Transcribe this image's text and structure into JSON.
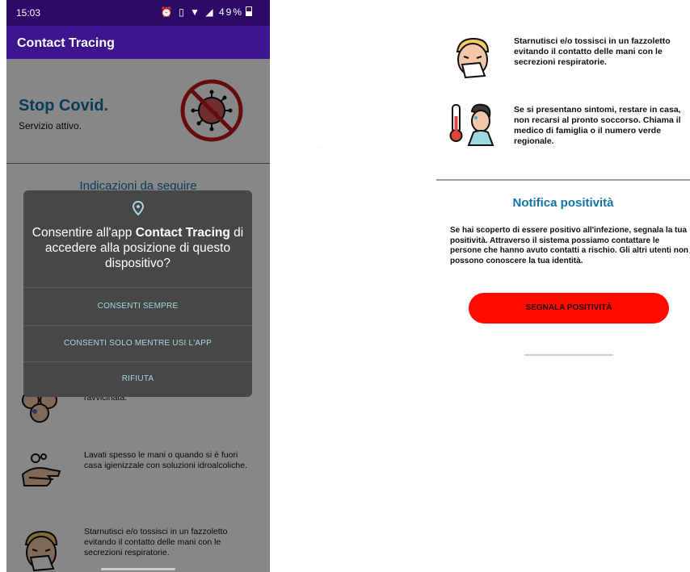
{
  "status_bar": {
    "time": "15:03",
    "battery": "49%"
  },
  "app_bar": {
    "title": "Contact Tracing"
  },
  "hero": {
    "title": "Stop Covid.",
    "subtitle": "Servizio attivo."
  },
  "section_left": {
    "title": "Indicazioni da seguire"
  },
  "tips_left": [
    {
      "text": "con scarsa ventilazione e la distanza ravvicinata.",
      "icon": "crowd-icon"
    },
    {
      "text": "Lavati spesso le mani o quando si è fuori casa igienizzale con soluzioni idroalcoliche.",
      "icon": "hand-wash-icon"
    },
    {
      "text": "Starnutisci e/o tossisci in un fazzoletto evitando il contatto delle mani con le secrezioni respiratorie.",
      "icon": "sneeze-icon"
    }
  ],
  "dialog": {
    "title_part1": "Consentire all'app ",
    "title_app": "Contact Tracing",
    "title_part2": " di accedere alla posizione di questo dispositivo?",
    "buttons": {
      "allow_always": "CONSENTI SEMPRE",
      "allow_while_using": "CONSENTI SOLO MENTRE USI L'APP",
      "deny": "RIFIUTA"
    }
  },
  "tips_right": [
    {
      "text": "Starnutisci e/o tossisci in un fazzoletto evitando il contatto delle mani con le secrezioni respiratorie.",
      "icon": "sneeze-icon"
    },
    {
      "text": "Se si presentano sintomi, restare in casa, non recarsi al pronto soccorso. Chiama il medico di famiglia o il numero verde regionale.",
      "icon": "fever-icon"
    }
  ],
  "notification": {
    "title": "Notifica positività",
    "text": "Se hai scoperto di essere positivo all'infezione, segnala la tua positività. Attraverso il sistema possiamo contattare le persone che hanno avuto contatti a rischio. Gli altri utenti non possono conoscere la tua identità.",
    "button": "SEGNALA POSITIVITÀ"
  },
  "colors": {
    "status_bar": "#2b0a68",
    "app_bar": "#3d168f",
    "accent_blue": "#1474a6",
    "dialog_bg": "#474747",
    "dialog_button": "#a7d8de",
    "report_button": "#ff0c00"
  }
}
